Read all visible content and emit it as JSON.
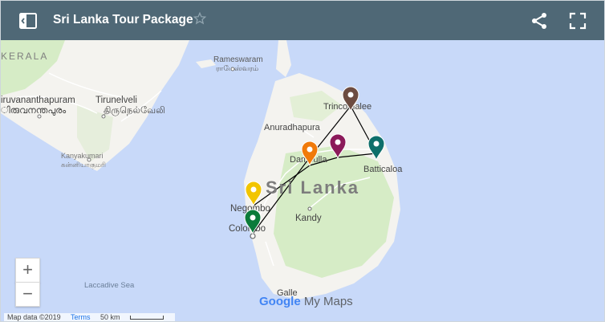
{
  "header": {
    "title": "Sri Lanka Tour Package",
    "icons": [
      "map-panel-icon",
      "star-icon",
      "share-icon",
      "fullscreen-icon"
    ]
  },
  "map": {
    "country_label": "Sri Lanka",
    "places": {
      "kerala": "KERALA",
      "rameswaram": "Rameswaram",
      "rameswaram_tamil": "ராமேஸ்வரம்",
      "thiruvananthapuram": "iruvananthapuram",
      "thiruvananthapuram_ml": "ിരുവനന്തപുരം",
      "tirunelveli": "Tirunelveli",
      "tirunelveli_tamil": "திருநெல்வேலி",
      "kanyakumari": "Kanyakumari",
      "kanyakumari_tamil": "கன்னியாகுமரி",
      "anuradhapura": "Anuradhapura",
      "trincomalee": "Trincomalee",
      "dambulla": "Dambulla",
      "batticaloa": "Batticaloa",
      "negombo": "Negombo",
      "colombo": "Colombo",
      "kandy": "Kandy",
      "galle": "Galle",
      "laccadive_sea": "Laccadive Sea"
    },
    "markers": [
      {
        "name": "negombo-marker",
        "color": "#f2c500"
      },
      {
        "name": "colombo-marker",
        "color": "#0b7b3a"
      },
      {
        "name": "dambulla-marker",
        "color": "#f07a0a"
      },
      {
        "name": "sigiriya-marker",
        "color": "#8b1a5a"
      },
      {
        "name": "trincomalee-marker",
        "color": "#6d4c41"
      },
      {
        "name": "batticaloa-marker",
        "color": "#0e6f6a"
      }
    ]
  },
  "controls": {
    "zoom_in": "+",
    "zoom_out": "−"
  },
  "footer": {
    "map_data": "Map data ©2019",
    "terms": "Terms",
    "scale": "50 km"
  },
  "brand": {
    "google": "Google",
    "my_maps": "My Maps"
  },
  "colors": {
    "header": "#4f6876",
    "sea": "#c8d9f9",
    "land": "#f4f3ef",
    "vegetation": "#d6ecc6",
    "route": "#000000"
  }
}
